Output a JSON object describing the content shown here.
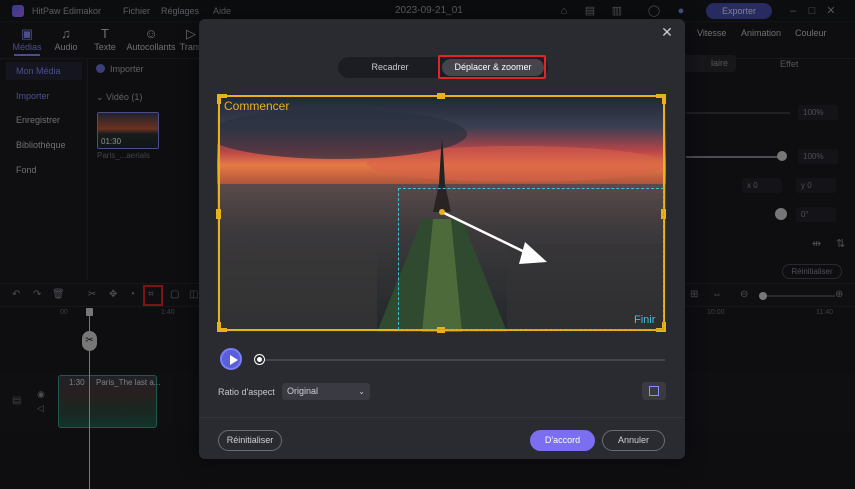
{
  "app": {
    "name": "HitPaw Edimakor",
    "menu": [
      "Fichier",
      "Réglages",
      "Aide"
    ],
    "project_date": "2023-09-21_01",
    "export_label": "Exporter"
  },
  "toolbar": {
    "tabs": [
      {
        "label": "Médias",
        "icon": "media-icon",
        "glyph": "▣"
      },
      {
        "label": "Audio",
        "icon": "music-icon",
        "glyph": "♫"
      },
      {
        "label": "Texte",
        "icon": "text-icon",
        "glyph": "T"
      },
      {
        "label": "Autocollants",
        "icon": "sticker-icon",
        "glyph": "☺"
      },
      {
        "label": "Trans",
        "icon": "transition-icon",
        "glyph": "▷"
      }
    ]
  },
  "sidebar": {
    "items": [
      "Mon Média",
      "Importer",
      "Enregistrer",
      "Bibliothèque",
      "Fond"
    ]
  },
  "media": {
    "import_label": "Importer",
    "video_section": "Vidéo",
    "video_count": "(1)",
    "thumb_duration": "01:30",
    "thumb_name": "Paris_...aerials"
  },
  "right_panel": {
    "tabs": [
      "Vitesse",
      "Animation",
      "Couleur"
    ],
    "subtab_active": "laire",
    "subtab_other": "Effet",
    "value1": "100%",
    "value2": "100%",
    "pos_x": "0",
    "pos_y": "0",
    "rotation": "0°",
    "reset_label": "Réinitialiser"
  },
  "timeline": {
    "ruler": [
      "00",
      "1:40",
      "10:00",
      "11:40"
    ],
    "clip_time": "1:30",
    "clip_name": "Paris_The last a..."
  },
  "dialog": {
    "tab_crop": "Recadrer",
    "tab_move_zoom": "Déplacer & zoomer",
    "start_label": "Commencer",
    "end_label": "Finir",
    "ratio_label": "Ratio d'aspect",
    "ratio_value": "Original",
    "reset_label": "Réinitialiser",
    "ok_label": "D'accord",
    "cancel_label": "Annuler"
  },
  "colors": {
    "accent": "#8b8fff",
    "start_frame": "#e8b21a",
    "end_frame": "#3bc4d6",
    "highlight": "#e0242a"
  }
}
